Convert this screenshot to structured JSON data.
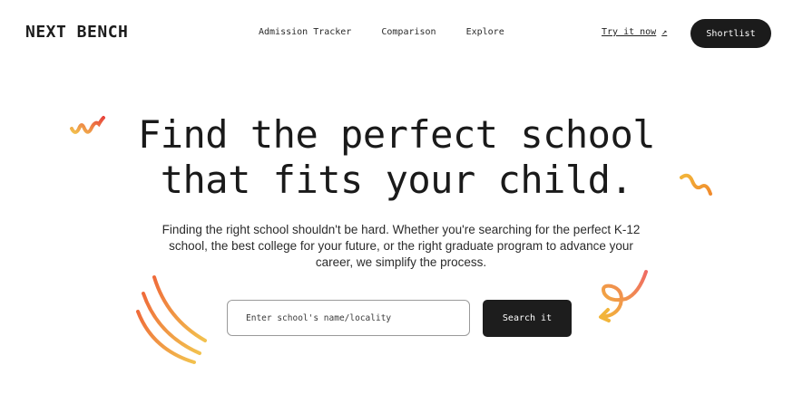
{
  "brand": {
    "name": "NEXT BENCH"
  },
  "nav": {
    "links": [
      "Admission Tracker",
      "Comparison",
      "Explore"
    ],
    "try_label": "Try it now",
    "try_icon": "arrow-up-right-icon",
    "shortlist_label": "Shortlist"
  },
  "hero": {
    "headline_line1": "Find the perfect school",
    "headline_line2": "that fits your child.",
    "subtext": "Finding the right school shouldn't be hard. Whether you're searching for the perfect K-12 school, the best college for your future, or the right graduate program to advance your career, we simplify the process."
  },
  "search": {
    "placeholder": "Enter school's name/locality",
    "value": "",
    "button_label": "Search it"
  },
  "colors": {
    "accent_red": "#e8453c",
    "accent_orange": "#f08a2c",
    "accent_yellow": "#f2c14e",
    "accent_salmon": "#ef7b63",
    "dark": "#1b1b1b"
  }
}
